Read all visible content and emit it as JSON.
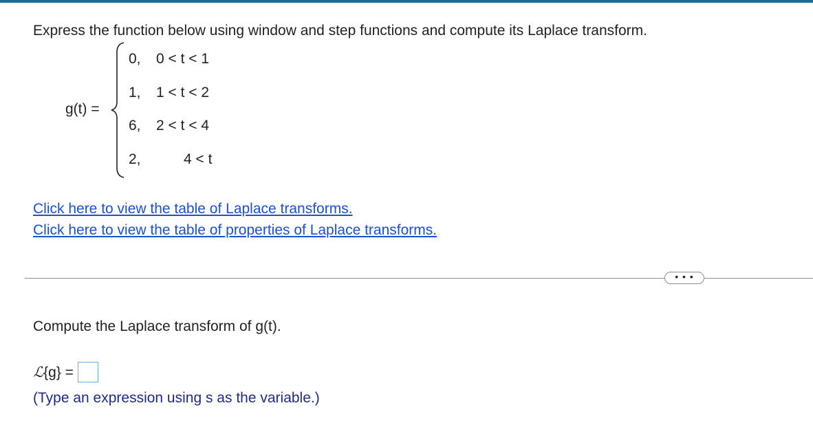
{
  "problem": {
    "prompt": "Express the function below using window and step functions and compute its Laplace transform.",
    "function_label": "g(t) =",
    "cases": [
      {
        "value": "0,",
        "condition": "0 < t < 1"
      },
      {
        "value": "1,",
        "condition": "1 < t < 2"
      },
      {
        "value": "6,",
        "condition": "2 < t < 4"
      },
      {
        "value": "2,",
        "condition": "4 < t"
      }
    ]
  },
  "links": {
    "laplace_table": "Click here to view the table of Laplace transforms.",
    "properties_table": "Click here to view the table of properties of Laplace transforms."
  },
  "more_button": {
    "label": "• • •"
  },
  "question": {
    "text": "Compute the Laplace transform of g(t).",
    "answer_label_script": "ℒ",
    "answer_label_rest": "{g} =",
    "answer_value": "",
    "hint": "(Type an expression using s as the variable.)"
  },
  "colors": {
    "top_bar": "#1a6e97",
    "link": "#1a4fd6",
    "hint": "#1e2a8a",
    "input_border": "#6ab0d8"
  }
}
